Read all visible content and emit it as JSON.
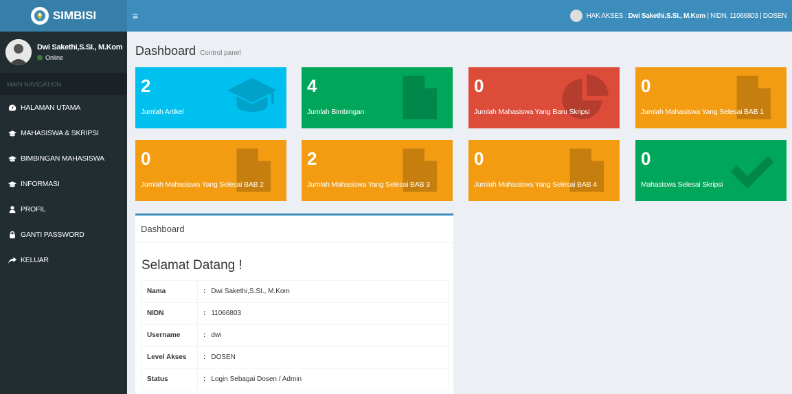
{
  "app": {
    "name": "SIMBISI"
  },
  "sidebar": {
    "user_name": "Dwi Sakethi,S.SI., M.Kom",
    "user_status": "Online",
    "nav_header": "MAIN NAVIGATION",
    "items": [
      {
        "label": "HALAMAN UTAMA",
        "icon": "dashboard-icon"
      },
      {
        "label": "MAHASISWA & SKRIPSI",
        "icon": "graduation-cap-icon"
      },
      {
        "label": "BIMBINGAN MAHASISWA",
        "icon": "graduation-cap-icon"
      },
      {
        "label": "INFORMASI",
        "icon": "graduation-cap-icon"
      },
      {
        "label": "PROFIL",
        "icon": "user-icon"
      },
      {
        "label": "GANTI PASSWORD",
        "icon": "lock-icon"
      },
      {
        "label": "KELUAR",
        "icon": "share-icon"
      }
    ]
  },
  "header": {
    "menu_toggle": "≡",
    "access_prefix": "HAK AKSES :",
    "access_name": "Dwi Sakethi,S.SI., M.Kom",
    "access_suffix": "| NIDN. 11066803 | DOSEN"
  },
  "main": {
    "title": "Dashboard",
    "subtitle": "Control panel",
    "boxes": [
      {
        "number": "2",
        "label": "Jumlah Artikel",
        "color": "#00c0ef",
        "icon": "graduation-cap-icon"
      },
      {
        "number": "4",
        "label": "Jumlah Bimbingan",
        "color": "#00a65a",
        "icon": "file-icon"
      },
      {
        "number": "0",
        "label": "Jumlah Mahasiswa Yang Baru Skripsi",
        "color": "#dd4b39",
        "icon": "pie-chart-icon"
      },
      {
        "number": "0",
        "label": "Jumlah Mahasiswa Yang Selesai BAB 1",
        "color": "#f39c12",
        "icon": "file-icon"
      },
      {
        "number": "0",
        "label": "Jumlah Mahasiswa Yang Selesai BAB 2",
        "color": "#f39c12",
        "icon": "file-icon"
      },
      {
        "number": "2",
        "label": "Jumlah Mahasiswa Yang Selesai BAB 3",
        "color": "#f39c12",
        "icon": "file-icon"
      },
      {
        "number": "0",
        "label": "Jumlah Mahasiswa Yang Selesai BAB 4",
        "color": "#f39c12",
        "icon": "file-icon"
      },
      {
        "number": "0",
        "label": "Mahasiswa Selesai Skripsi",
        "color": "#00a65a",
        "icon": "check-icon"
      }
    ],
    "panel": {
      "header": "Dashboard",
      "welcome": "Selamat Datang !",
      "separator": ":",
      "rows": [
        {
          "key": "Nama",
          "value": "Dwi Sakethi,S.SI., M.Kom"
        },
        {
          "key": "NIDN",
          "value": "11066803"
        },
        {
          "key": "Username",
          "value": "dwi"
        },
        {
          "key": "Level Akses",
          "value": "DOSEN"
        },
        {
          "key": "Status",
          "value": "Login Sebagai Dosen / Admin"
        }
      ]
    }
  }
}
